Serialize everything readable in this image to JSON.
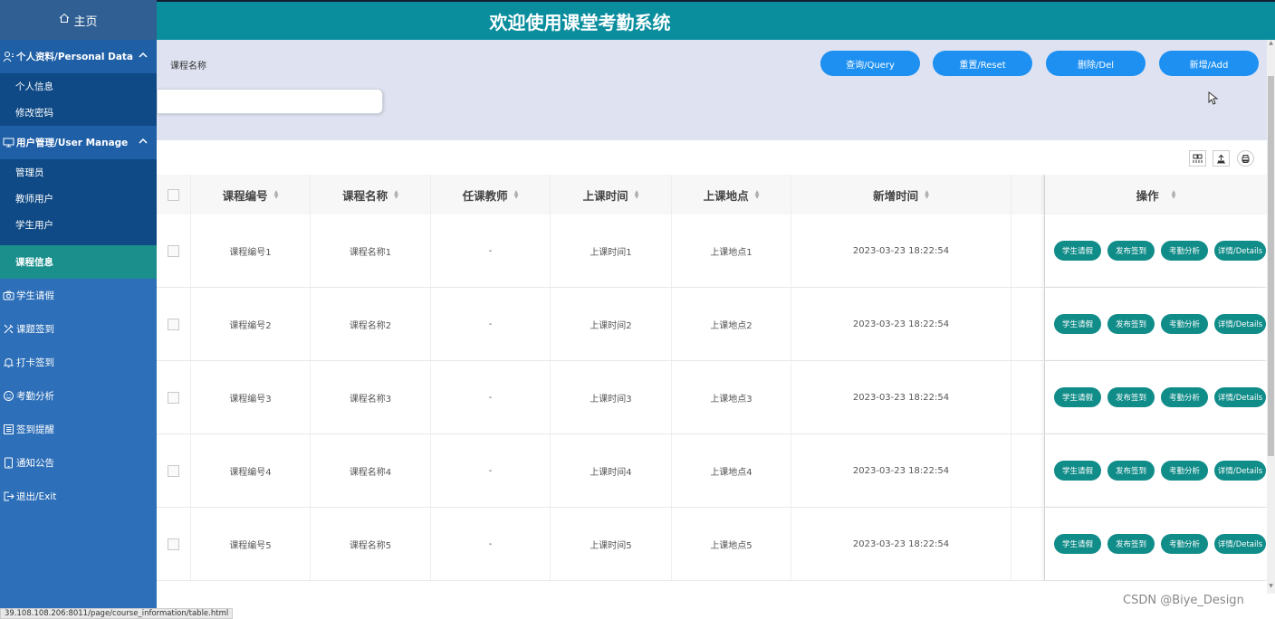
{
  "sidebar": {
    "home_label": "主页",
    "group_personal": {
      "label": "个人资料/Personal Data",
      "items": [
        "个人信息",
        "修改密码"
      ]
    },
    "group_user": {
      "label": "用户管理/User Manage",
      "items": [
        "管理员",
        "教师用户",
        "学生用户"
      ]
    },
    "active_item": "课程信息",
    "nav": [
      {
        "label": "学生请假",
        "icon": "camera-icon"
      },
      {
        "label": "课题签到",
        "icon": "tools-icon"
      },
      {
        "label": "打卡签到",
        "icon": "bell-icon"
      },
      {
        "label": "考勤分析",
        "icon": "face-icon"
      },
      {
        "label": "签到提醒",
        "icon": "list-icon"
      },
      {
        "label": "通知公告",
        "icon": "tablet-icon"
      },
      {
        "label": "退出/Exit",
        "icon": "logout-icon"
      }
    ]
  },
  "header": {
    "title": "欢迎使用课堂考勤系统"
  },
  "search": {
    "label": "课程名称",
    "value": "",
    "buttons": {
      "query": "查询/Query",
      "reset": "重置/Reset",
      "delete": "删除/Del",
      "add": "新增/Add"
    }
  },
  "table": {
    "columns": [
      "课程编号",
      "课程名称",
      "任课教师",
      "上课时间",
      "上课地点",
      "新增时间",
      "",
      "操作"
    ],
    "rows": [
      [
        "课程编号1",
        "课程名称1",
        "-",
        "上课时间1",
        "上课地点1",
        "2023-03-23 18:22:54"
      ],
      [
        "课程编号2",
        "课程名称2",
        "-",
        "上课时间2",
        "上课地点2",
        "2023-03-23 18:22:54"
      ],
      [
        "课程编号3",
        "课程名称3",
        "-",
        "上课时间3",
        "上课地点3",
        "2023-03-23 18:22:54"
      ],
      [
        "课程编号4",
        "课程名称4",
        "-",
        "上课时间4",
        "上课地点4",
        "2023-03-23 18:22:54"
      ],
      [
        "课程编号5",
        "课程名称5",
        "-",
        "上课时间5",
        "上课地点5",
        "2023-03-23 18:22:54"
      ]
    ],
    "actions": [
      "学生请假",
      "发布签到",
      "考勤分析",
      "详情/Details"
    ]
  },
  "statusbar": {
    "url": "39.108.108.206:8011/page/course_information/table.html"
  },
  "watermark": "CSDN @Biye_Design",
  "colors": {
    "sidebar": "#2d6fb8",
    "header": "#0a8e9e",
    "active": "#1a8f8c",
    "primary_button": "#1e90f2",
    "action_button": "#108c89"
  }
}
